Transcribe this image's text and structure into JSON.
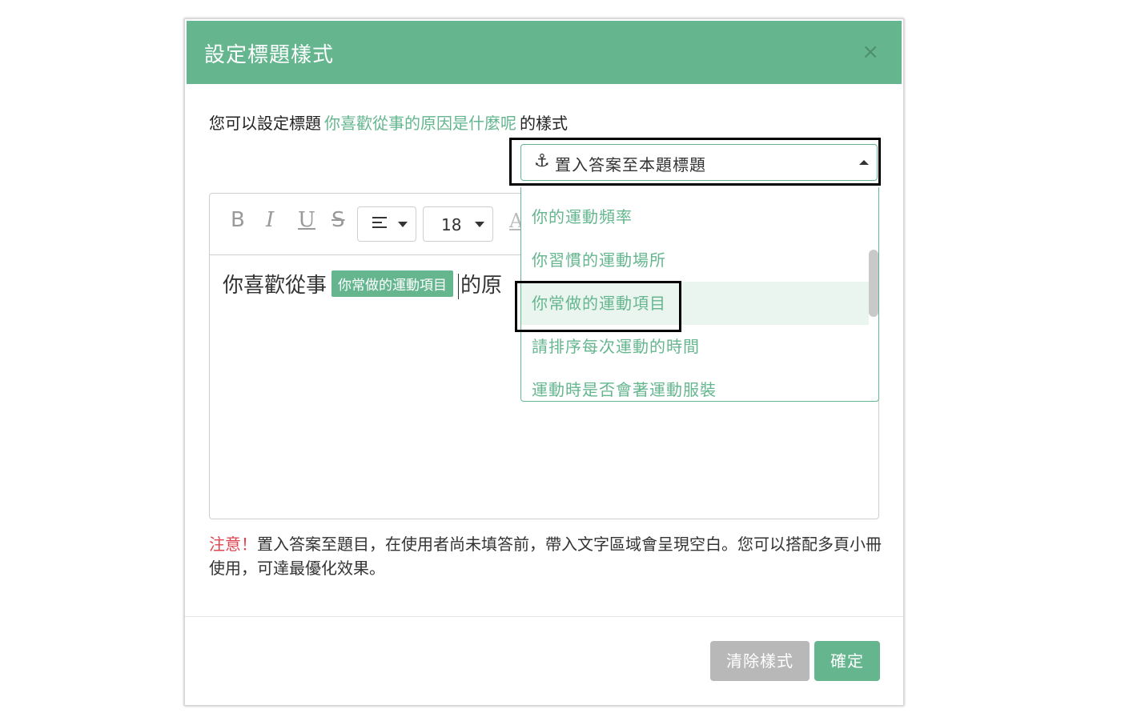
{
  "dialog": {
    "title": "設定標題樣式",
    "close_symbol": "×"
  },
  "intro": {
    "prefix": "您可以設定標題",
    "question": "你喜歡從事的原因是什麼呢",
    "suffix": "的樣式"
  },
  "select": {
    "icon": "anchor-icon",
    "icon_glyph": "⚓",
    "label": "置入答案至本題標題"
  },
  "toolbar": {
    "bold": "B",
    "italic": "I",
    "underline": "U",
    "strike": "S",
    "align_icon": "align-left-icon",
    "font_size": "18",
    "font_color": "A"
  },
  "editor": {
    "text_before": "你喜歡從事",
    "tag": "你常做的運動項目",
    "text_after": "的原"
  },
  "menu": {
    "items": [
      {
        "label": "你的運動頻率"
      },
      {
        "label": "你習慣的運動場所"
      },
      {
        "label": "你常做的運動項目"
      },
      {
        "label": "請排序每次運動的時間"
      },
      {
        "label": "運動時是否會著運動服裝"
      }
    ]
  },
  "notice": {
    "warn": "注意！",
    "text": "置入答案至題目，在使用者尚未填答前，帶入文字區域會呈現空白。您可以搭配多頁小冊使用，可達最優化效果。"
  },
  "buttons": {
    "clear": "清除樣式",
    "confirm": "確定"
  },
  "colors": {
    "brand": "#65b68f",
    "warn": "#e0454f",
    "disabled": "#b8b8b8"
  }
}
